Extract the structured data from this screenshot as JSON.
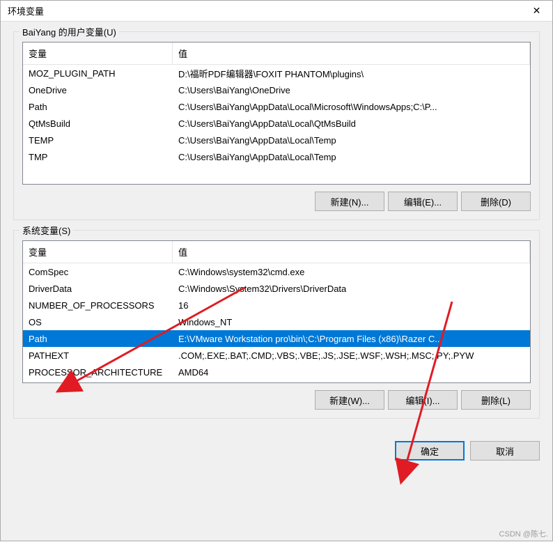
{
  "dialog_title": "环境变量",
  "close_glyph": "✕",
  "user_vars": {
    "group_label": "BaiYang 的用户变量(U)",
    "columns": {
      "var": "变量",
      "val": "值"
    },
    "rows": [
      {
        "var": "MOZ_PLUGIN_PATH",
        "val": "D:\\福昕PDF编辑器\\FOXIT PHANTOM\\plugins\\"
      },
      {
        "var": "OneDrive",
        "val": "C:\\Users\\BaiYang\\OneDrive"
      },
      {
        "var": "Path",
        "val": "C:\\Users\\BaiYang\\AppData\\Local\\Microsoft\\WindowsApps;C:\\P..."
      },
      {
        "var": "QtMsBuild",
        "val": "C:\\Users\\BaiYang\\AppData\\Local\\QtMsBuild"
      },
      {
        "var": "TEMP",
        "val": "C:\\Users\\BaiYang\\AppData\\Local\\Temp"
      },
      {
        "var": "TMP",
        "val": "C:\\Users\\BaiYang\\AppData\\Local\\Temp"
      }
    ],
    "buttons": {
      "new": "新建(N)...",
      "edit": "编辑(E)...",
      "delete": "删除(D)"
    }
  },
  "sys_vars": {
    "group_label": "系统变量(S)",
    "columns": {
      "var": "变量",
      "val": "值"
    },
    "rows": [
      {
        "var": "ComSpec",
        "val": "C:\\Windows\\system32\\cmd.exe"
      },
      {
        "var": "DriverData",
        "val": "C:\\Windows\\System32\\Drivers\\DriverData"
      },
      {
        "var": "NUMBER_OF_PROCESSORS",
        "val": "16"
      },
      {
        "var": "OS",
        "val": "Windows_NT"
      },
      {
        "var": "Path",
        "val": "E:\\VMware Workstation pro\\bin\\;C:\\Program Files (x86)\\Razer C...",
        "selected": true
      },
      {
        "var": "PATHEXT",
        "val": ".COM;.EXE;.BAT;.CMD;.VBS;.VBE;.JS;.JSE;.WSF;.WSH;.MSC;.PY;.PYW"
      },
      {
        "var": "PROCESSOR_ARCHITECTURE",
        "val": "AMD64"
      }
    ],
    "buttons": {
      "new": "新建(W)...",
      "edit": "编辑(I)...",
      "delete": "删除(L)"
    }
  },
  "footer": {
    "ok": "确定",
    "cancel": "取消"
  },
  "watermark": "CSDN @陈七."
}
